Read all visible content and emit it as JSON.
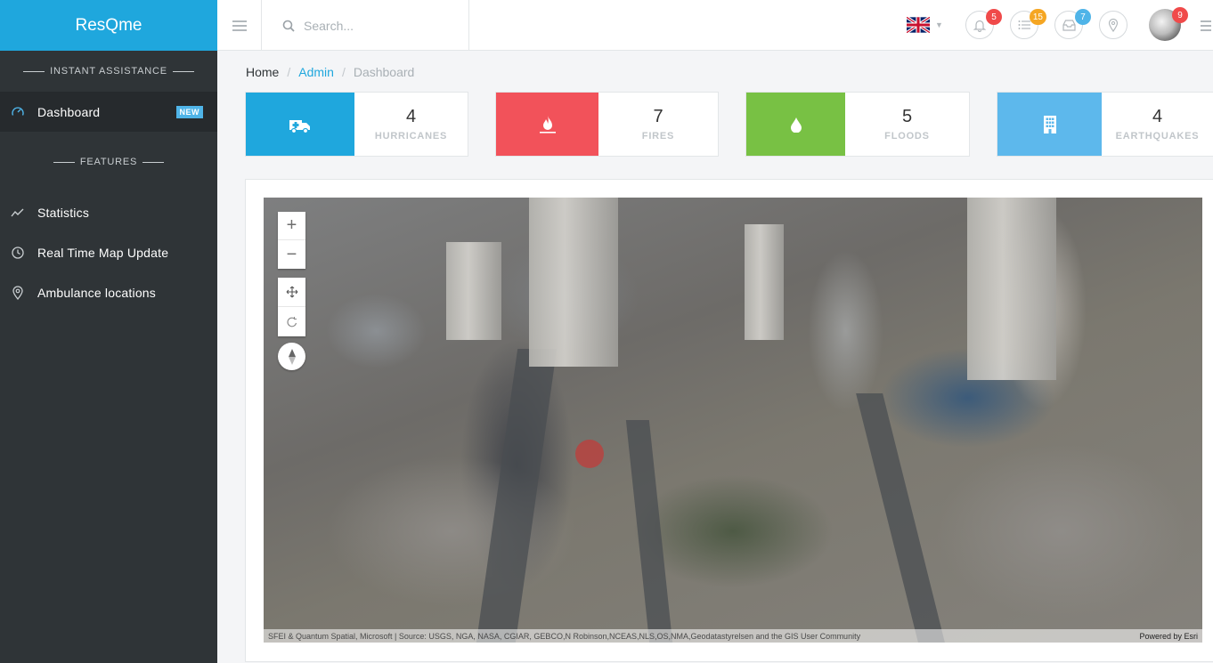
{
  "app": {
    "brand": "ResQme"
  },
  "sidebar": {
    "heading_instant": "INSTANT ASSISTANCE",
    "heading_features": "FEATURES",
    "items": [
      {
        "label": "Dashboard",
        "icon": "dashboard-gauge-icon",
        "badge": "NEW",
        "active": true
      },
      {
        "label": "Statistics",
        "icon": "line-chart-icon"
      },
      {
        "label": "Real Time Map Update",
        "icon": "clock-icon"
      },
      {
        "label": "Ambulance locations",
        "icon": "map-pin-icon"
      }
    ]
  },
  "topbar": {
    "search_placeholder": "Search...",
    "language_icon": "uk-flag-icon",
    "notifications": {
      "icon": "bell-icon",
      "count": "5",
      "color": "#f04a4a"
    },
    "tasks": {
      "icon": "list-icon",
      "count": "15",
      "color": "#f5a623"
    },
    "messages": {
      "icon": "inbox-icon",
      "count": "7",
      "color": "#4fb4e8"
    },
    "location_icon": "map-pin-icon",
    "avatar_count": "9",
    "avatar_count_color": "#f04a4a"
  },
  "breadcrumb": {
    "home": "Home",
    "admin": "Admin",
    "current": "Dashboard"
  },
  "stats": [
    {
      "value": "4",
      "label": "HURRICANES",
      "icon": "ambulance-icon",
      "color": "#1fa7dd"
    },
    {
      "value": "7",
      "label": "FIRES",
      "icon": "fire-icon",
      "color": "#f2525a"
    },
    {
      "value": "5",
      "label": "FLOODS",
      "icon": "water-drop-icon",
      "color": "#78c144"
    },
    {
      "value": "4",
      "label": "EARTHQUAKES",
      "icon": "building-icon",
      "color": "#5db8ec"
    }
  ],
  "map": {
    "attribution": "SFEI & Quantum Spatial, Microsoft | Source: USGS, NGA, NASA, CGIAR, GEBCO,N Robinson,NCEAS,NLS,OS,NMA,Geodatastyrelsen and the GIS User Community",
    "powered_by": "Powered by Esri"
  }
}
